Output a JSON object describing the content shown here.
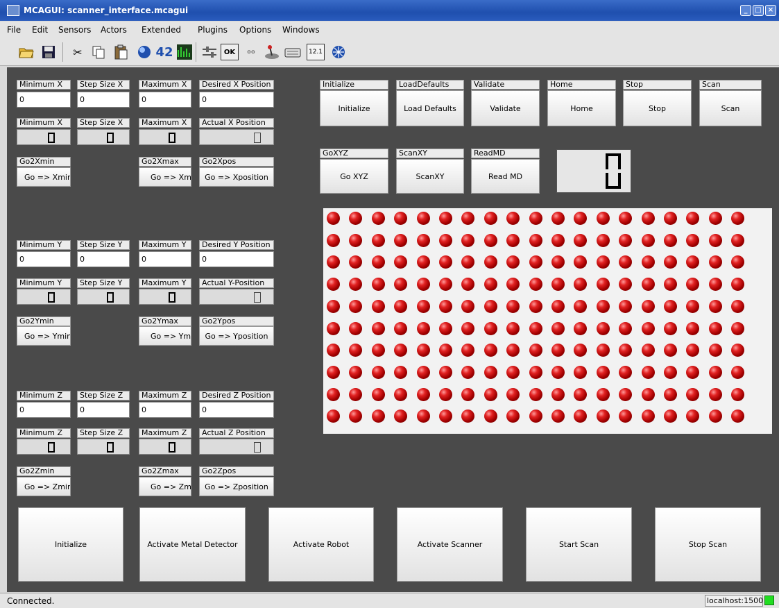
{
  "window": {
    "title": "MCAGUI: scanner_interface.mcagui",
    "controls": [
      "_",
      "□",
      "×"
    ]
  },
  "menu": [
    "File",
    "Edit",
    "Sensors",
    "Actors",
    "Extended",
    "Plugins",
    "Options",
    "Windows"
  ],
  "toolbar": {
    "icons": [
      "open-folder-icon",
      "save-disk-icon",
      "cut-scissors-icon",
      "copy-icon",
      "paste-clipboard-icon",
      "globe-icon",
      "number-42-icon",
      "equalizer-icon",
      "slider-icon",
      "ok-button-icon",
      "key-value-icon",
      "joystick-icon",
      "keyboard-icon",
      "numeric-display-icon",
      "clock-icon"
    ],
    "num_label": "42",
    "ok_label": "OK",
    "lcd_label": "12.1"
  },
  "axes": [
    {
      "min_label": "Minimum X",
      "step_label": "Step Size X",
      "max_label": "Maximum X",
      "desired_label": "Desired X Position",
      "min_value": "0",
      "step_value": "0",
      "max_value": "0",
      "desired_value": "0",
      "min_disp_label": "Minimum X",
      "step_disp_label": "Step Size X",
      "max_disp_label": "Maximum X",
      "actual_label": "Actual X Position",
      "gomin_label": "Go2Xmin",
      "gomax_label": "Go2Xmax",
      "gopos_label": "Go2Xpos",
      "gomin_btn": "Go => Xmin",
      "gomax_btn": "Go => Xmax",
      "gopos_btn": "Go => Xposition"
    },
    {
      "min_label": "Minimum Y",
      "step_label": "Step Size Y",
      "max_label": "Maximum Y",
      "desired_label": "Desired Y Position",
      "min_value": "0",
      "step_value": "0",
      "max_value": "0",
      "desired_value": "0",
      "min_disp_label": "Minimum Y",
      "step_disp_label": "Step Size Y",
      "max_disp_label": "Maximum Y",
      "actual_label": "Actual Y-Position",
      "gomin_label": "Go2Ymin",
      "gomax_label": "Go2Ymax",
      "gopos_label": "Go2Ypos",
      "gomin_btn": "Go => Ymin",
      "gomax_btn": "Go => Ymax",
      "gopos_btn": "Go => Yposition"
    },
    {
      "min_label": "Minimum Z",
      "step_label": "Step Size Z",
      "max_label": "Maximum Z",
      "desired_label": "Desired Z Position",
      "min_value": "0",
      "step_value": "0",
      "max_value": "0",
      "desired_value": "0",
      "min_disp_label": "Minimum Z",
      "step_disp_label": "Step Size Z",
      "max_disp_label": "Maximum Z",
      "actual_label": "Actual Z Position",
      "gomin_label": "Go2Zmin",
      "gomax_label": "Go2Zmax",
      "gopos_label": "Go2Zpos",
      "gomin_btn": "Go => Zmin",
      "gomax_btn": "Go => Zmax",
      "gopos_btn": "Go => Zposition"
    }
  ],
  "commands_row1": [
    {
      "label": "Initialize",
      "button": "Initialize"
    },
    {
      "label": "LoadDefaults",
      "button": "Load Defaults"
    },
    {
      "label": "Validate",
      "button": "Validate"
    },
    {
      "label": "Home",
      "button": "Home"
    },
    {
      "label": "Stop",
      "button": "Stop"
    },
    {
      "label": "Scan",
      "button": "Scan"
    }
  ],
  "commands_row2": [
    {
      "label": "GoXYZ",
      "button": "Go XYZ"
    },
    {
      "label": "ScanXY",
      "button": "ScanXY"
    },
    {
      "label": "ReadMD",
      "button": "Read MD"
    }
  ],
  "led_grid": {
    "rows": 10,
    "cols": 19,
    "color": "#cc0000"
  },
  "bottom_buttons": [
    "Initialize",
    "Activate Metal Detector",
    "Activate Robot",
    "Activate Scanner",
    "Start Scan",
    "Stop Scan"
  ],
  "status": {
    "text": "Connected.",
    "host": "localhost:1500",
    "led_color": "#22dd22"
  },
  "colors": {
    "panel": "#4a4a4a",
    "titlebar": "#2a5bbd"
  }
}
